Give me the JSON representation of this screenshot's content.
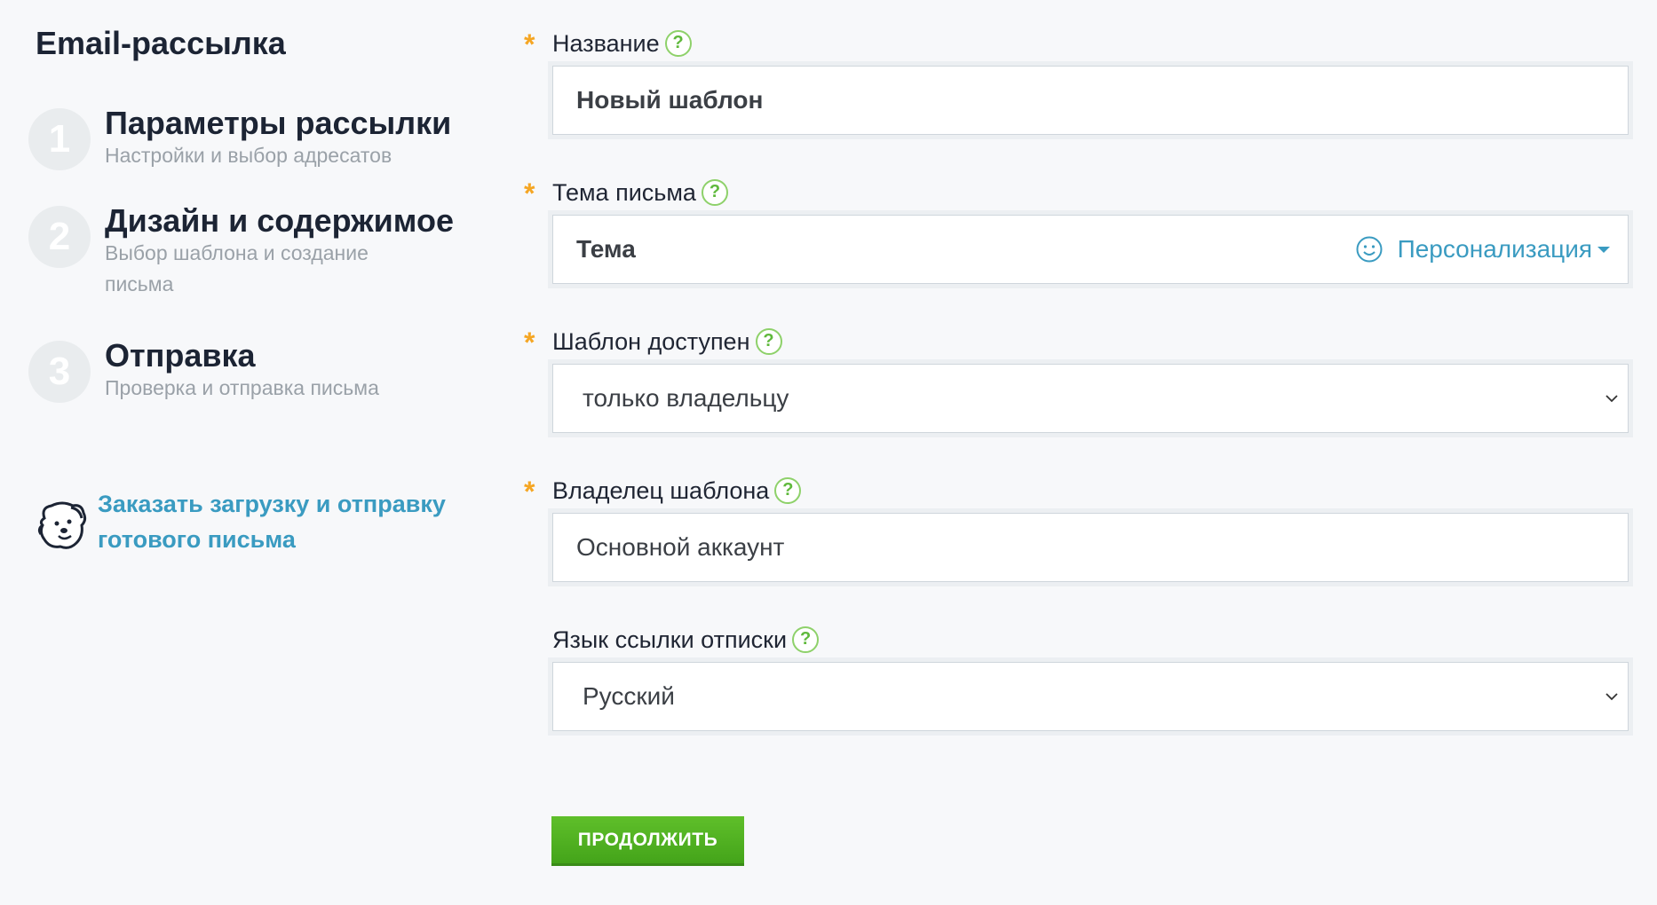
{
  "page": {
    "title": "Email-рассылка"
  },
  "steps": [
    {
      "number": "1",
      "title": "Параметры рассылки",
      "description": "Настройки и выбор адресатов"
    },
    {
      "number": "2",
      "title": "Дизайн и содержимое",
      "description": "Выбор шаблона и создание письма"
    },
    {
      "number": "3",
      "title": "Отправка",
      "description": "Проверка и отправка письма"
    }
  ],
  "helper": {
    "link_text": "Заказать загрузку и отправку готового письма",
    "icon": "dog-mascot-icon"
  },
  "form": {
    "name": {
      "label": "Название",
      "required": "*",
      "value": "Новый шаблон"
    },
    "subject": {
      "label": "Тема письма",
      "required": "*",
      "value": "Тема",
      "personalization": "Персонализация"
    },
    "availability": {
      "label": "Шаблон доступен",
      "required": "*",
      "value": "только владельцу"
    },
    "owner": {
      "label": "Владелец шаблона",
      "required": "*",
      "value": "Основной аккаунт"
    },
    "unsub_lang": {
      "label": "Язык ссылки отписки",
      "value": "Русский"
    }
  },
  "help_glyph": "?",
  "actions": {
    "continue": "ПРОДОЛЖИТЬ"
  },
  "colors": {
    "accent": "#3a9bc1",
    "required": "#f5a623",
    "help": "#5fb93c",
    "button": "#4cae1f"
  }
}
